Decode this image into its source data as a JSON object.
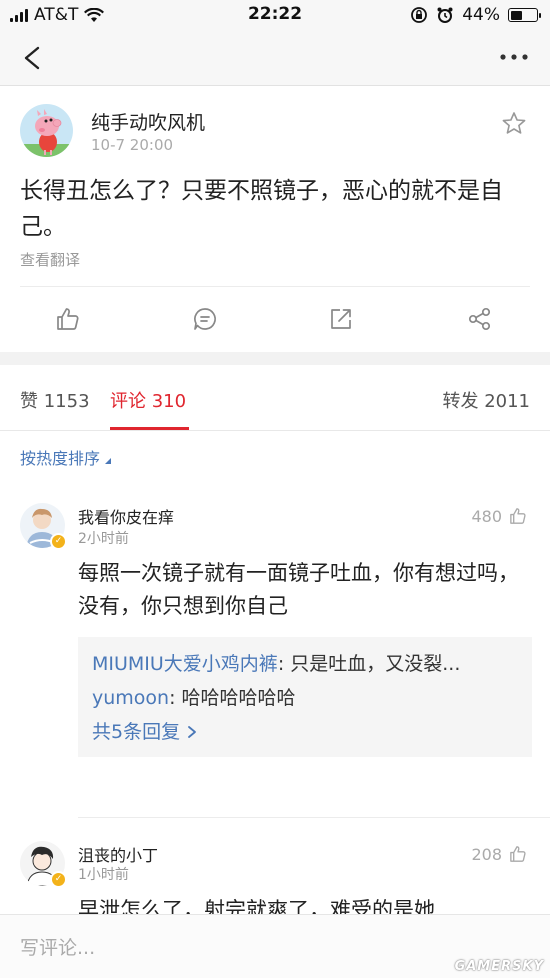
{
  "status_bar": {
    "carrier": "AT&T",
    "time": "22:22",
    "battery": "44%",
    "battery_level": 0.44
  },
  "nav": {
    "back_icon": "chevron-left-icon",
    "more_icon": "more-dots-icon"
  },
  "post": {
    "username": "纯手动吹风机",
    "time": "10-7 20:00",
    "text": "长得丑怎么了？只要不照镜子，恶心的就不是自己。",
    "translate_label": "查看翻译",
    "actions": [
      "thumbs-up-icon",
      "comment-icon",
      "forward-icon",
      "share-icon"
    ]
  },
  "tabs": {
    "likes": "赞 1153",
    "comments": "评论 310",
    "reposts": "转发 2011",
    "active_color": "#e0262f"
  },
  "sort_label": "按热度排序",
  "comments": [
    {
      "username": "我看你皮在痒",
      "time": "2小时前",
      "likes": "480",
      "text": "每照一次镜子就有一面镜子吐血，你有想过吗，没有，你只想到你自己",
      "replies": [
        {
          "name": "MIUMIU大爱小鸡内裤",
          "sep": ": ",
          "text": "只是吐血，又没裂..."
        },
        {
          "name": "yumoon",
          "sep": ": ",
          "text": "哈哈哈哈哈哈"
        }
      ],
      "more_replies": "共5条回复"
    },
    {
      "username": "沮丧的小丁",
      "time": "1小时前",
      "likes": "208",
      "text": "早泄怎么了，射完就爽了，难受的是她"
    }
  ],
  "bottom": {
    "placeholder": "写评论...",
    "watermark": "GAMERSKY"
  }
}
